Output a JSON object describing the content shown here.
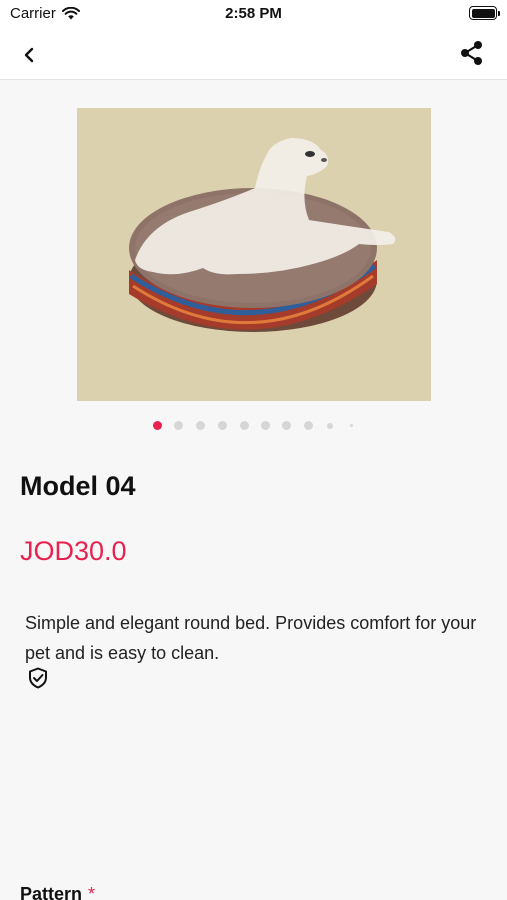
{
  "status_bar": {
    "carrier": "Carrier",
    "time": "2:58 PM"
  },
  "nav": {
    "back_icon": "chevron-left-icon",
    "share_icon": "share-icon"
  },
  "carousel": {
    "total_pages": 10,
    "current_page": 1
  },
  "product": {
    "title": "Model 04",
    "price": "JOD30.0",
    "description": "Simple and elegant round bed. Provides comfort for your pet and is easy to clean.",
    "guarantee_icon": "shield-check-icon"
  },
  "options": {
    "pattern_label": "Pattern",
    "required_marker": "*"
  },
  "colors": {
    "accent": "#e8224f",
    "image_background": "#dcd1ae",
    "page_background": "#f7f7f7"
  }
}
